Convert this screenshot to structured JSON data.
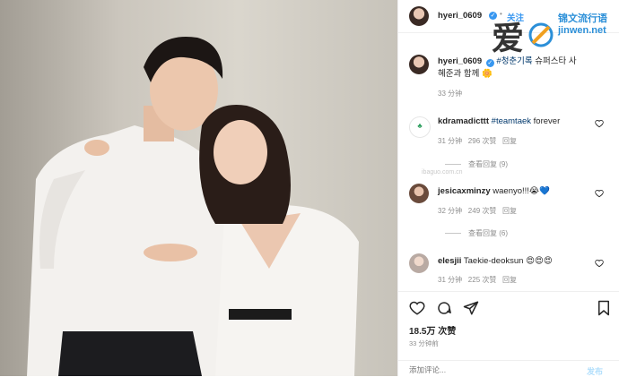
{
  "header": {
    "username": "hyeri_0609",
    "follow_label": "关注"
  },
  "caption": {
    "username": "hyeri_0609",
    "hashtag": "#청춘기록",
    "line1_rest": "슈퍼스타 사",
    "line2": "혜준과 함께",
    "emoji": "🌼",
    "time": "33 分钟"
  },
  "comments": [
    {
      "username": "kdramadicttt",
      "link": "#teamtaek",
      "text": "forever",
      "time": "31 分钟",
      "likes": "296 次赞",
      "reply": "回复",
      "view_replies": "查看回复 (9)"
    },
    {
      "username": "jesicaxminzy",
      "link": "",
      "text": "waenyo!!!😭💙",
      "time": "32 分钟",
      "likes": "249 次赞",
      "reply": "回复",
      "view_replies": "查看回复 (6)"
    },
    {
      "username": "elesjii",
      "link": "",
      "text": "Taekie-deoksun 😍😍😍",
      "time": "31 分钟",
      "likes": "225 次赞",
      "reply": "回复",
      "view_replies": ""
    }
  ],
  "footer": {
    "likes": "18.5万 次赞",
    "time": "33 分钟前",
    "add_comment_placeholder": "添加评论...",
    "post_label": "发布"
  },
  "watermark": {
    "brand_big": "爱",
    "brand_small": "锦文流行语",
    "brand_url": "jinwen.net",
    "faint_url": "ibaguo.com.cn"
  },
  "colors": {
    "accent": "#3897f0",
    "link": "#00376b",
    "muted": "#8e8e8e"
  }
}
